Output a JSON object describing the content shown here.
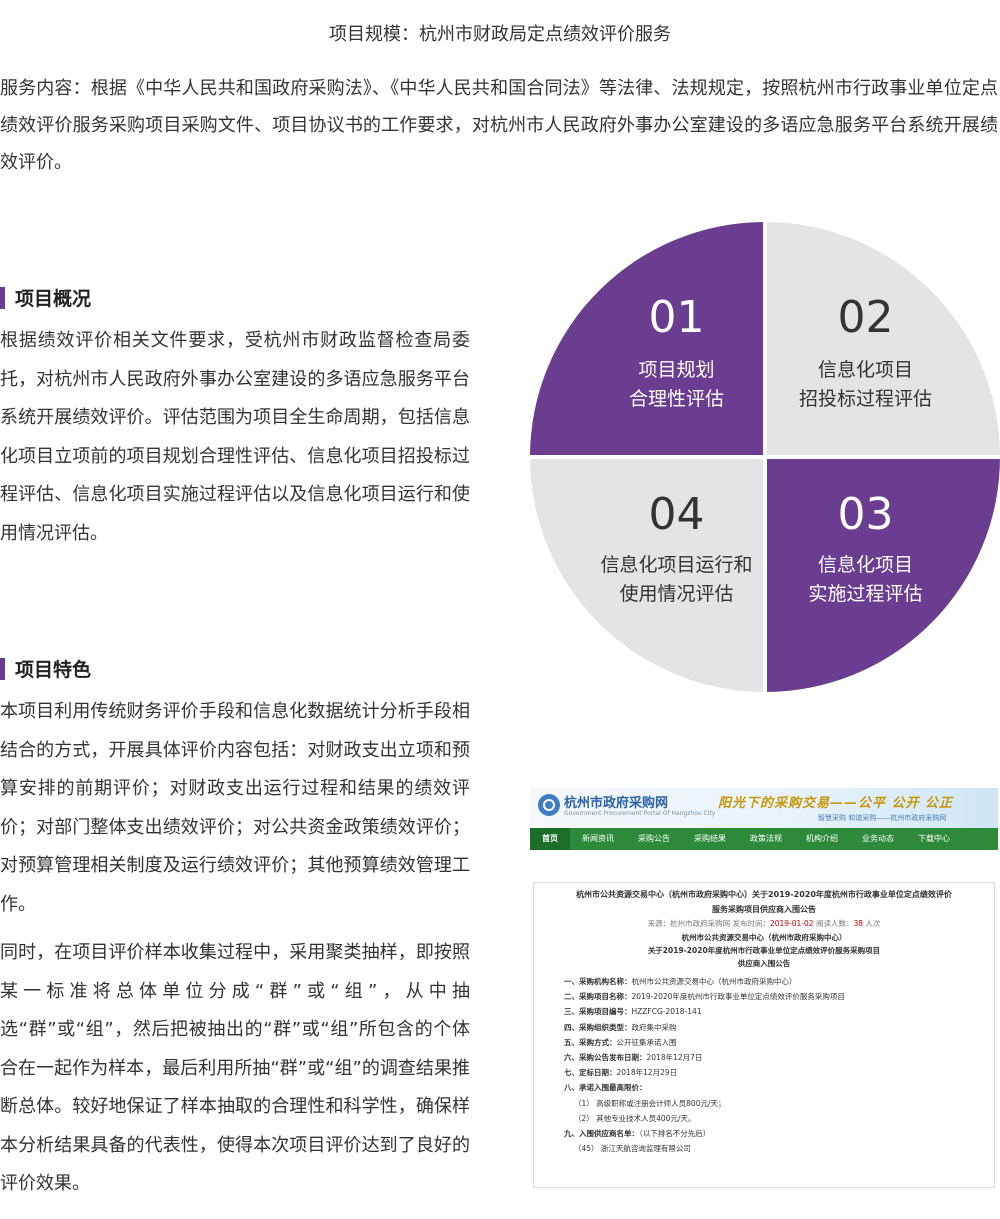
{
  "top_title": "项目规模：杭州市财政局定点绩效评价服务",
  "intro": "服务内容：根据《中华人民共和国政府采购法》、《中华人民共和国合同法》等法律、法规规定，按照杭州市行政事业单位定点绩效评价服务采购项目采购文件、项目协议书的工作要求，对杭州市人民政府外事办公室建设的多语应急服务平台系统开展绩效评价。",
  "overview": {
    "heading": "项目概况",
    "text": "根据绩效评价相关文件要求，受杭州市财政监督检查局委托，对杭州市人民政府外事办公室建设的多语应急服务平台系统开展绩效评价。评估范围为项目全生命周期，包括信息化项目立项前的项目规划合理性评估、信息化项目招投标过程评估、信息化项目实施过程评估以及信息化项目运行和使用情况评估。"
  },
  "features": {
    "heading": "项目特色",
    "text1": "本项目利用传统财务评价手段和信息化数据统计分析手段相结合的方式，开展具体评价内容包括：对财政支出立项和预算安排的前期评价；对财政支出运行过程和结果的绩效评价；对部门整体支出绩效评价；对公共资金政策绩效评价；对预算管理相关制度及运行绩效评价；其他预算绩效管理工作。",
    "text2": "同时，在项目评价样本收集过程中，采用聚类抽样，即按照某一标准将总体单位分成“群”或“组”，从中抽选“群”或“组”，然后把被抽出的“群”或“组”所包含的个体合在一起作为样本，最后利用所抽“群”或“组”的调查结果推断总体。较好地保证了样本抽取的合理性和科学性，确保样本分析结果具备的代表性，使得本次项目评价达到了良好的评价效果。"
  },
  "quadrants": [
    {
      "num": "01",
      "line1": "项目规划",
      "line2": "合理性评估",
      "color": "#6b3d90"
    },
    {
      "num": "02",
      "line1": "信息化项目",
      "line2": "招投标过程评估",
      "color": "#e4e4e6"
    },
    {
      "num": "04",
      "line1": "信息化项目运行和",
      "line2": "使用情况评估",
      "color": "#e4e4e6"
    },
    {
      "num": "03",
      "line1": "信息化项目",
      "line2": "实施过程评估",
      "color": "#6b3d90"
    }
  ],
  "screenshot": {
    "site_name": "杭州市政府采购网",
    "site_en": "Government Procurement Portal Of Hangzhou City",
    "slogan": "阳光下的采购交易——公平  公开  公正",
    "sub_slogan": "智慧采购   和谐采购——杭州市政府采购网",
    "nav": [
      "首页",
      "新闻资讯",
      "采购公告",
      "采购结果",
      "政策法规",
      "机构介绍",
      "业务动态",
      "下载中心"
    ],
    "doc_title_1": "杭州市公共资源交易中心（杭州市政府采购中心）关于2019-2020年度杭州市行政事业单位定点绩效评价",
    "doc_title_2": "服务采购项目供应商入围公告",
    "meta_source": "来源：杭州市政府采购网   发布时间：",
    "meta_date": "2019-01-02",
    "meta_views_label": "   阅读人数：",
    "meta_views": "38",
    "meta_views_unit": " 人次",
    "h2_1": "杭州市公共资源交易中心（杭州市政府采购中心）",
    "h2_2": "关于2019-2020年度杭州市行政事业单位定点绩效评价服务采购项目",
    "h2_3": "供应商入围公告",
    "lines": [
      {
        "k": "一、采购机构名称：",
        "v": "杭州市公共资源交易中心（杭州市政府采购中心）"
      },
      {
        "k": "二、采购项目名称：",
        "v": "2019-2020年度杭州市行政事业单位定点绩效评价服务采购项目"
      },
      {
        "k": "三、采购项目编号：",
        "v": "HZZFCG-2018-141"
      },
      {
        "k": "四、采购组织类型：",
        "v": "政府集中采购"
      },
      {
        "k": "五、采购方式：",
        "v": "公开征集承诺入围"
      },
      {
        "k": "六、采购公告发布日期：",
        "v": "2018年12月7日"
      },
      {
        "k": "七、定标日期：",
        "v": "2018年12月29日"
      },
      {
        "k": "八、承诺入围最高限价：",
        "v": ""
      }
    ],
    "sub_lines": [
      "（1）  高级职称或注册会计师人员800元/天；",
      "（2）  其他专业技术人员400元/天。"
    ],
    "line_nine": {
      "k": "九、入围供应商名单：",
      "v": "（以下排名不分先后）"
    },
    "last_line": "（45）      浙江天航咨询监理有限公司"
  }
}
